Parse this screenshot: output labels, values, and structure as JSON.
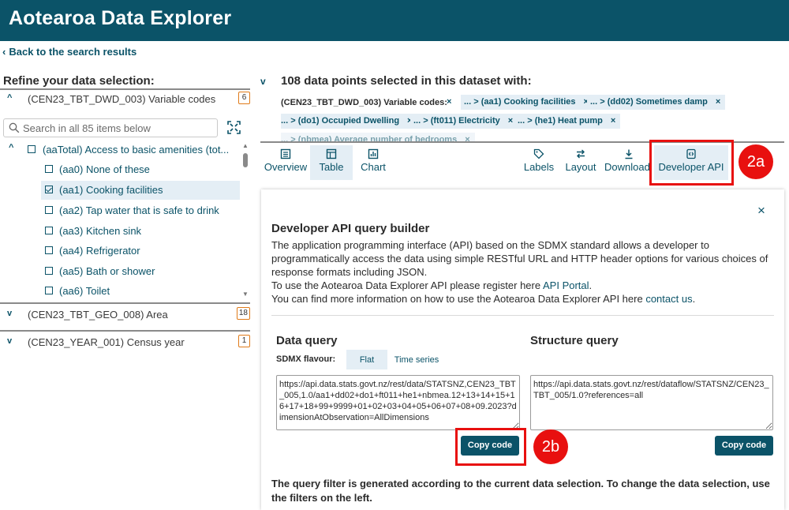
{
  "header": {
    "title": "Aotearoa Data Explorer",
    "bg_color": "#0b5368"
  },
  "nav": {
    "back_label": "Back to the search results"
  },
  "left_panel": {
    "title": "Refine your data selection:",
    "dimensions": [
      {
        "label": "(CEN23_TBT_DWD_003) Variable codes",
        "count": "6",
        "expanded": true
      },
      {
        "label": "(CEN23_TBT_GEO_008) Area",
        "count": "18",
        "expanded": false
      },
      {
        "label": "(CEN23_YEAR_001) Census year",
        "count": "1",
        "expanded": false
      }
    ],
    "search": {
      "placeholder": "Search in all 85 items below"
    },
    "tree_items": [
      {
        "label": "(aaTotal) Access to basic amenities (tot...",
        "checked": false,
        "level": 0
      },
      {
        "label": "(aa0) None of these",
        "checked": false,
        "level": 1
      },
      {
        "label": "(aa1) Cooking facilities",
        "checked": true,
        "level": 1
      },
      {
        "label": "(aa2) Tap water that is safe to drink",
        "checked": false,
        "level": 1
      },
      {
        "label": "(aa3) Kitchen sink",
        "checked": false,
        "level": 1
      },
      {
        "label": "(aa4) Refrigerator",
        "checked": false,
        "level": 1
      },
      {
        "label": "(aa5) Bath or shower",
        "checked": false,
        "level": 1
      },
      {
        "label": "(aa6) Toilet",
        "checked": false,
        "level": 1
      }
    ]
  },
  "selection": {
    "heading": "108 data points selected in this dataset with:",
    "chip_group_label": "(CEN23_TBT_DWD_003) Variable codes:",
    "chips": [
      "... > (aa1) Cooking facilities",
      "... > (dd02) Sometimes damp",
      "... > (do1) Occupied Dwelling",
      "... > (ft011) Electricity",
      "... > (he1) Heat pump",
      "... > (nbmea) Average number of bedrooms"
    ],
    "chip_close": "×"
  },
  "toolbar": {
    "overview": "Overview",
    "table": "Table",
    "chart": "Chart",
    "labels": "Labels",
    "layout": "Layout",
    "download": "Download",
    "developer_api": "Developer API"
  },
  "callouts": {
    "a": "2a",
    "b": "2b"
  },
  "api_panel": {
    "close": "×",
    "title": "Developer API query builder",
    "desc_line1": "The application programming interface (API) based on the SDMX standard allows a developer to programmatically access the data using simple RESTful URL and HTTP header options for various choices of response formats including JSON.",
    "desc_line2_pre": "To use the Aotearoa Data Explorer API please register here ",
    "desc_line2_link": "API Portal",
    "desc_line2_post": ".",
    "desc_line3_pre": "You can find more information on how to use the Aotearoa Data Explorer API here ",
    "desc_line3_link": "contact us",
    "desc_line3_post": ".",
    "data_query": {
      "title": "Data query",
      "flavour_label": "SDMX flavour:",
      "flavour_options": [
        "Flat",
        "Time series"
      ],
      "url": "https://api.data.stats.govt.nz/rest/data/STATSNZ,CEN23_TBT_005,1.0/aa1+dd02+do1+ft011+he1+nbmea.12+13+14+15+16+17+18+99+9999+01+02+03+04+05+06+07+08+09.2023?dimensionAtObservation=AllDimensions",
      "copy_label": "Copy code"
    },
    "structure_query": {
      "title": "Structure query",
      "url": "https://api.data.stats.govt.nz/rest/dataflow/STATSNZ/CEN23_TBT_005/1.0?references=all",
      "copy_label": "Copy code"
    },
    "footer": "The query filter is generated according to the current data selection. To change the data selection, use the filters on the left."
  },
  "colors": {
    "accent": "#0b5368",
    "chip_bg": "#e4eef5",
    "callout": "#e8100f",
    "count_border": "#e07b1a"
  }
}
